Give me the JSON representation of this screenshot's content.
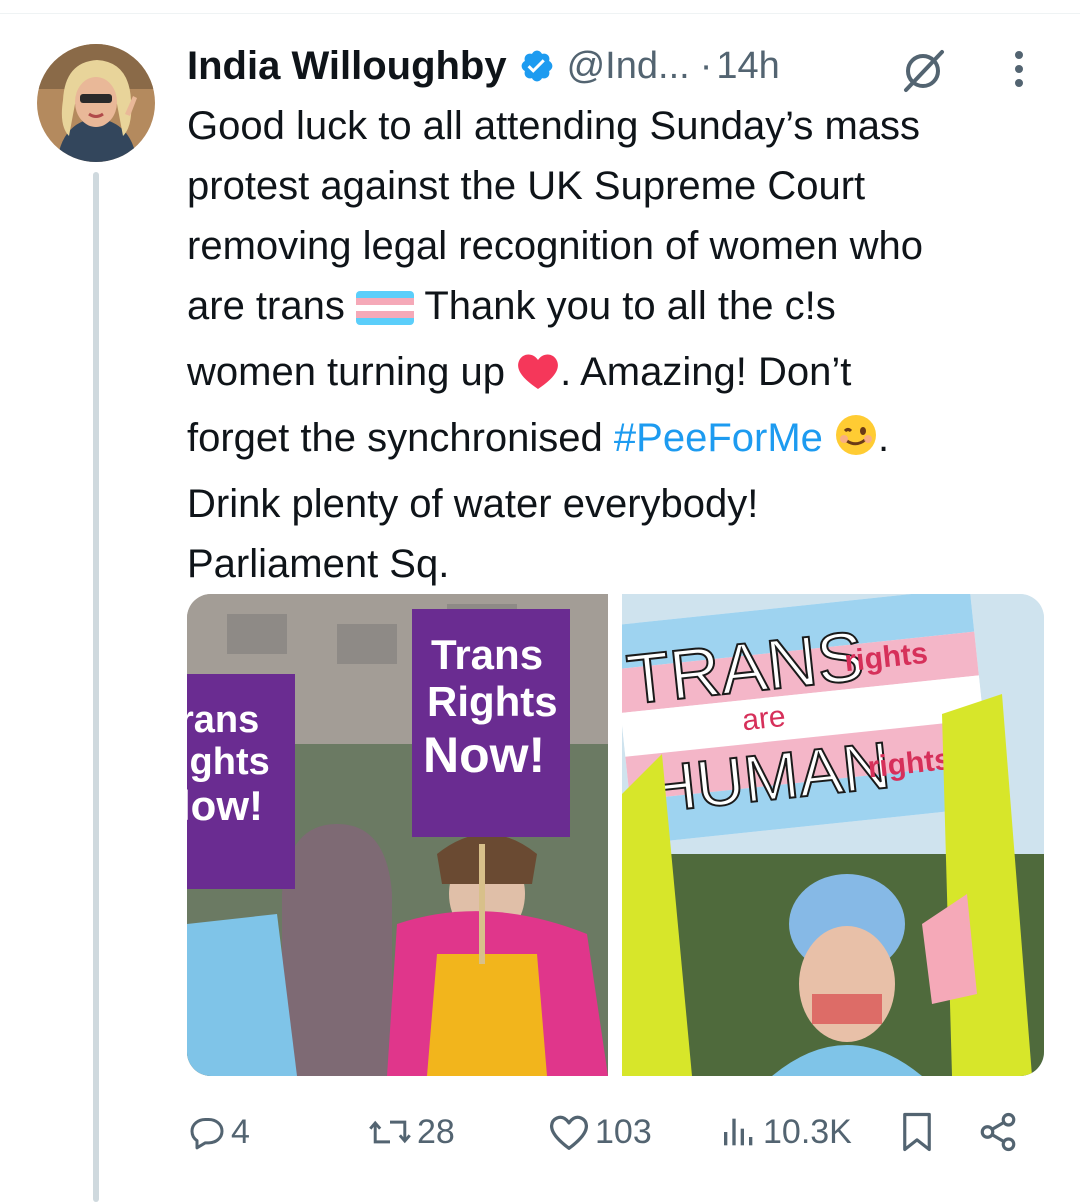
{
  "tweet": {
    "author_name": "India Willoughby",
    "handle": "@Ind...",
    "separator": "·",
    "time": "14h",
    "text_lines": [
      [
        "Good luck to all attending Sunday’s mass"
      ],
      [
        "protest against the UK Supreme Court"
      ],
      [
        "removing legal recognition of women who"
      ],
      [
        "are trans ",
        "Thank you to all the c!s"
      ],
      [
        "women turning up ",
        ". Amazing! Don’t"
      ],
      [
        "forget the synchronised ",
        "#PeeForMe",
        " ",
        "."
      ],
      [
        "Drink plenty of water everybody!"
      ],
      [
        "Parliament Sq."
      ]
    ],
    "text": {
      "l1": "Good luck to all attending Sunday’s mass",
      "l2": "protest against the UK Supreme Court",
      "l3": "removing legal recognition of women who",
      "l4a": "are trans ",
      "l4b": " Thank you to all the c!s",
      "l5a": "women turning up ",
      "l5b": ". Amazing! Don’t",
      "l6a": "forget the synchronised ",
      "l6b": "#PeeForMe",
      "l6c": " .",
      "l7": "Drink plenty of water everybody!",
      "l8": "Parliament Sq."
    },
    "emojis": [
      "transgender-flag",
      "red-heart",
      "winking-face"
    ],
    "media": {
      "left_sign_main": [
        "Trans",
        "Rights",
        "Now!"
      ],
      "left_sign_partial": [
        "rans",
        "ights",
        "low!"
      ],
      "right_sign": [
        "TRANS",
        "rights",
        "are",
        "HUMAN",
        "rights"
      ]
    }
  },
  "actions": {
    "replies": "4",
    "reposts": "28",
    "likes": "103",
    "views": "10.3K"
  },
  "colors": {
    "text": "#0f1419",
    "secondary": "#536471",
    "link": "#1d9bf0",
    "verified": "#1d9bf0",
    "thread_line": "#cfd9de",
    "sign_purple": "#6a2c91"
  },
  "icons": [
    "verified-badge-icon",
    "grok-icon",
    "more-icon",
    "reply-icon",
    "repost-icon",
    "like-icon",
    "views-icon",
    "bookmark-icon",
    "share-icon"
  ]
}
